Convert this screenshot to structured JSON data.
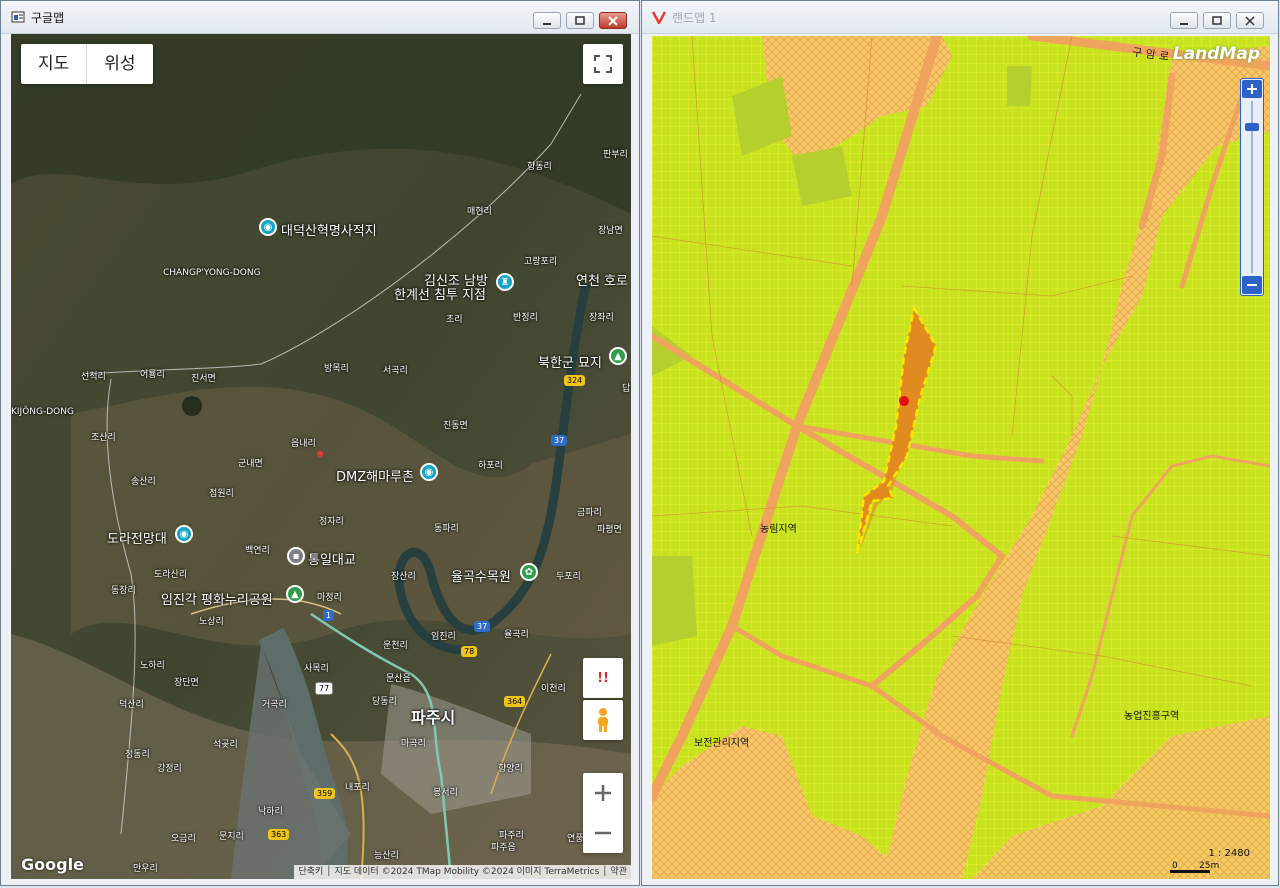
{
  "left_window": {
    "title": "구글맵",
    "map_type": {
      "map": "지도",
      "satellite": "위성"
    },
    "pois": [
      {
        "name": "대덕산혁명사적지"
      },
      {
        "name": "김신조 남방"
      },
      {
        "name": "한계선 침투 지점"
      },
      {
        "name": "연천 호로"
      },
      {
        "name": "북한군 묘지"
      },
      {
        "name": "DMZ해마루촌"
      },
      {
        "name": "도라전망대"
      },
      {
        "name": "통일대교"
      },
      {
        "name": "율곡수목원"
      },
      {
        "name": "임진각 평화누리공원"
      },
      {
        "name": "파주시"
      }
    ],
    "places": [
      "향동리",
      "판부리",
      "매현리",
      "장남면",
      "고랑포리",
      "CHANGP'YONG-DONG",
      "초리",
      "반정리",
      "장좌리",
      "선적리",
      "어룡리",
      "진서면",
      "방목리",
      "서곡리",
      "KIJŎNG-DONG",
      "조산리",
      "읍내리",
      "진동면",
      "송산리",
      "군내면",
      "점원리",
      "하포리",
      "금파리",
      "파평면",
      "정자리",
      "동파리",
      "백연리",
      "장산리",
      "두포리",
      "도라산리",
      "동장리",
      "마정리",
      "노상리",
      "운천리",
      "임진리",
      "율곡리",
      "사목리",
      "노하리",
      "장단면",
      "문산읍",
      "이천리",
      "덕산리",
      "당동리",
      "거곡리",
      "정동리",
      "석곶리",
      "강정리",
      "마곡리",
      "내포리",
      "봉서리",
      "향양리",
      "낙하리",
      "오금리",
      "문지리",
      "파주리",
      "파주읍",
      "만우리",
      "능산리",
      "연풍",
      "답"
    ],
    "route_shields": [
      "324",
      "37",
      "1",
      "37",
      "78",
      "77",
      "364",
      "359",
      "363"
    ],
    "attribution": "단축키 │ 지도 데이터 ©2024 TMap Mobility ©2024 이미지 TerraMetrics │ 약관",
    "logo": "Google",
    "streetview_warning": "!!"
  },
  "right_window": {
    "title": "랜드맵 1",
    "logo": "LandMap",
    "road_label": "구 암 로",
    "zones": [
      "농림지역",
      "보전관리지역",
      "농업진흥구역"
    ],
    "scale_ratio": "1 : 2480",
    "scale_zero": "0",
    "scale_length": "25m"
  },
  "colors": {
    "landmap_base": "#c8e21f",
    "landmap_road": "#f0a35e",
    "parcel_highlight": "#e08a20",
    "selection_border": "#ffe600",
    "marker": "#e01010"
  }
}
